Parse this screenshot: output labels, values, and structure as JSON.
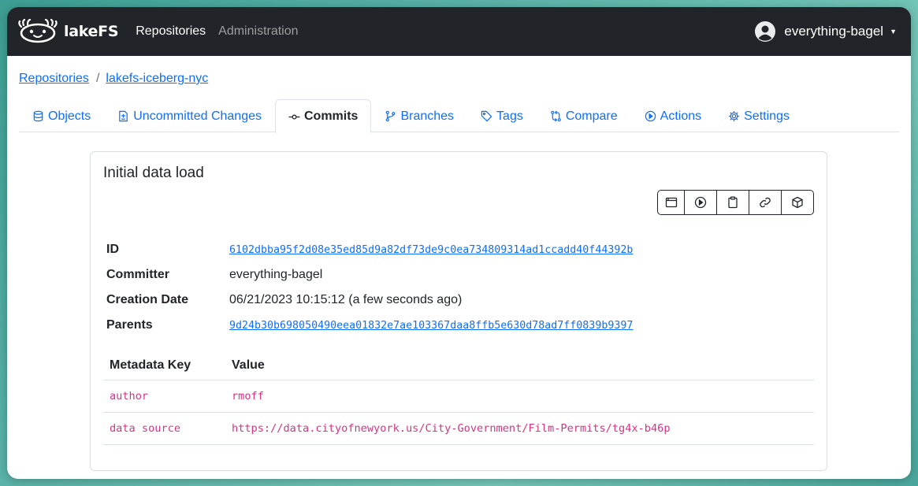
{
  "navbar": {
    "brand": "lakeFS",
    "links": [
      "Repositories",
      "Administration"
    ],
    "user": "everything-bagel"
  },
  "breadcrumb": {
    "root": "Repositories",
    "separator": "/",
    "repo": "lakefs-iceberg-nyc"
  },
  "tabs": [
    {
      "label": "Objects",
      "icon": "database-icon"
    },
    {
      "label": "Uncommitted Changes",
      "icon": "file-diff-icon"
    },
    {
      "label": "Commits",
      "icon": "git-commit-icon",
      "active": true
    },
    {
      "label": "Branches",
      "icon": "git-branch-icon"
    },
    {
      "label": "Tags",
      "icon": "tag-icon"
    },
    {
      "label": "Compare",
      "icon": "git-compare-icon"
    },
    {
      "label": "Actions",
      "icon": "play-icon"
    },
    {
      "label": "Settings",
      "icon": "gear-icon"
    }
  ],
  "commit": {
    "title": "Initial data load",
    "action_icons": [
      "browser-icon",
      "play-icon",
      "clipboard-icon",
      "link-icon",
      "package-icon"
    ],
    "properties": [
      {
        "key": "ID",
        "value": "6102dbba95f2d08e35ed85d9a82df73de9c0ea734809314ad1ccadd40f44392b"
      },
      {
        "key": "Committer",
        "value": "everything-bagel"
      },
      {
        "key": "Creation Date",
        "value": "06/21/2023 10:15:12 (a few seconds ago)"
      },
      {
        "key": "Parents",
        "value": "9d24b30b698050490eea01832e7ae103367daa8ffb5e630d78ad7ff0839b9397"
      }
    ],
    "metadata": {
      "headers": [
        "Metadata Key",
        "Value"
      ],
      "rows": [
        [
          "author",
          "rmoff"
        ],
        [
          "data source",
          "https://data.cityofnewyork.us/City-Government/Film-Permits/tg4x-b46p"
        ]
      ]
    }
  }
}
